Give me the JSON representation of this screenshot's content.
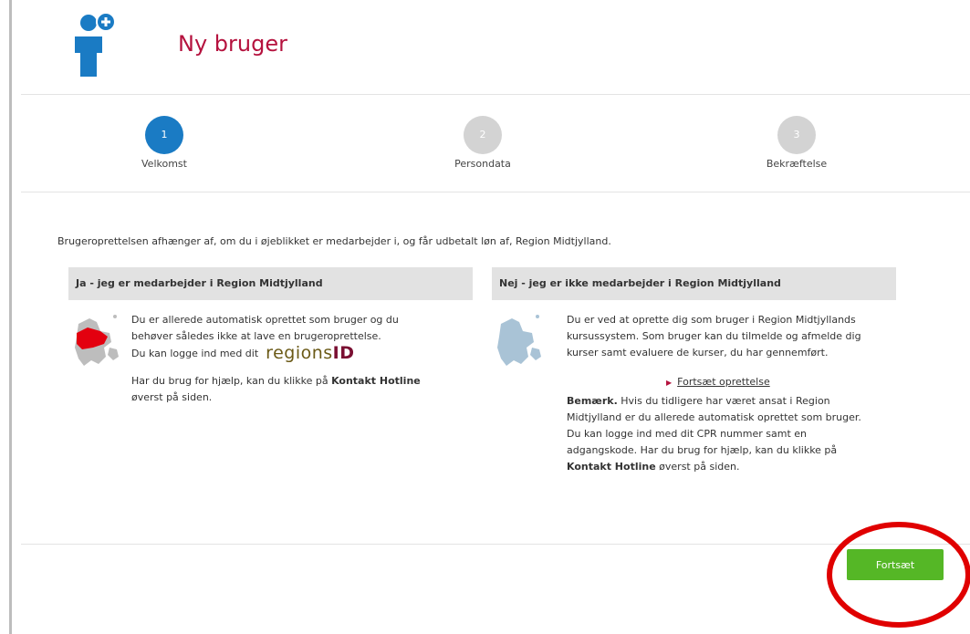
{
  "header": {
    "title": "Ny bruger",
    "icon": "add-user-icon"
  },
  "steps": [
    {
      "number": "1",
      "label": "Velkomst",
      "active": true
    },
    {
      "number": "2",
      "label": "Persondata",
      "active": false
    },
    {
      "number": "3",
      "label": "Bekræftelse",
      "active": false
    }
  ],
  "intro": "Brugeroprettelsen afhænger af, om du i øjeblikket er medarbejder i, og får udbetalt løn af, Region Midtjylland.",
  "panel_yes": {
    "heading": "Ja - jeg er medarbejder i Region Midtjylland",
    "line1": "Du er allerede automatisk oprettet som bruger og du",
    "line2": "behøver således ikke at lave en brugeroprettelse.",
    "line3": "Du kan logge ind med dit",
    "logo_prefix": "regions",
    "logo_suffix": "ID",
    "help_prefix": "Har du brug for hjælp, kan du klikke på",
    "help_bold": "Kontakt Hotline",
    "help_suffix": "øverst på siden."
  },
  "panel_no": {
    "heading": "Nej - jeg er ikke medarbejder i Region Midtjylland",
    "line1": "Du er ved at oprette dig som bruger i Region Midtjyllands",
    "line2": "kursussystem. Som bruger kan du tilmelde og afmelde dig",
    "line3": "kurser samt evaluere de kurser, du har gennemført.",
    "link": "Fortsæt oprettelse",
    "note_bold": "Bemærk.",
    "note_l1": "Hvis du tidligere har været ansat i Region",
    "note_l2": "Midtjylland er du allerede automatisk oprettet som bruger.",
    "note_l3": "Du kan logge ind med dit CPR nummer samt en",
    "note_l4": "adgangskode. Har du brug for hjælp, kan du klikke på",
    "note_bold2": "Kontakt Hotline",
    "note_l5": "øverst på siden."
  },
  "footer": {
    "next_label": "Fortsæt"
  },
  "colors": {
    "title": "#b5123e",
    "active_step": "#1a7bc4",
    "button": "#55b726",
    "highlight": "#e00000"
  }
}
